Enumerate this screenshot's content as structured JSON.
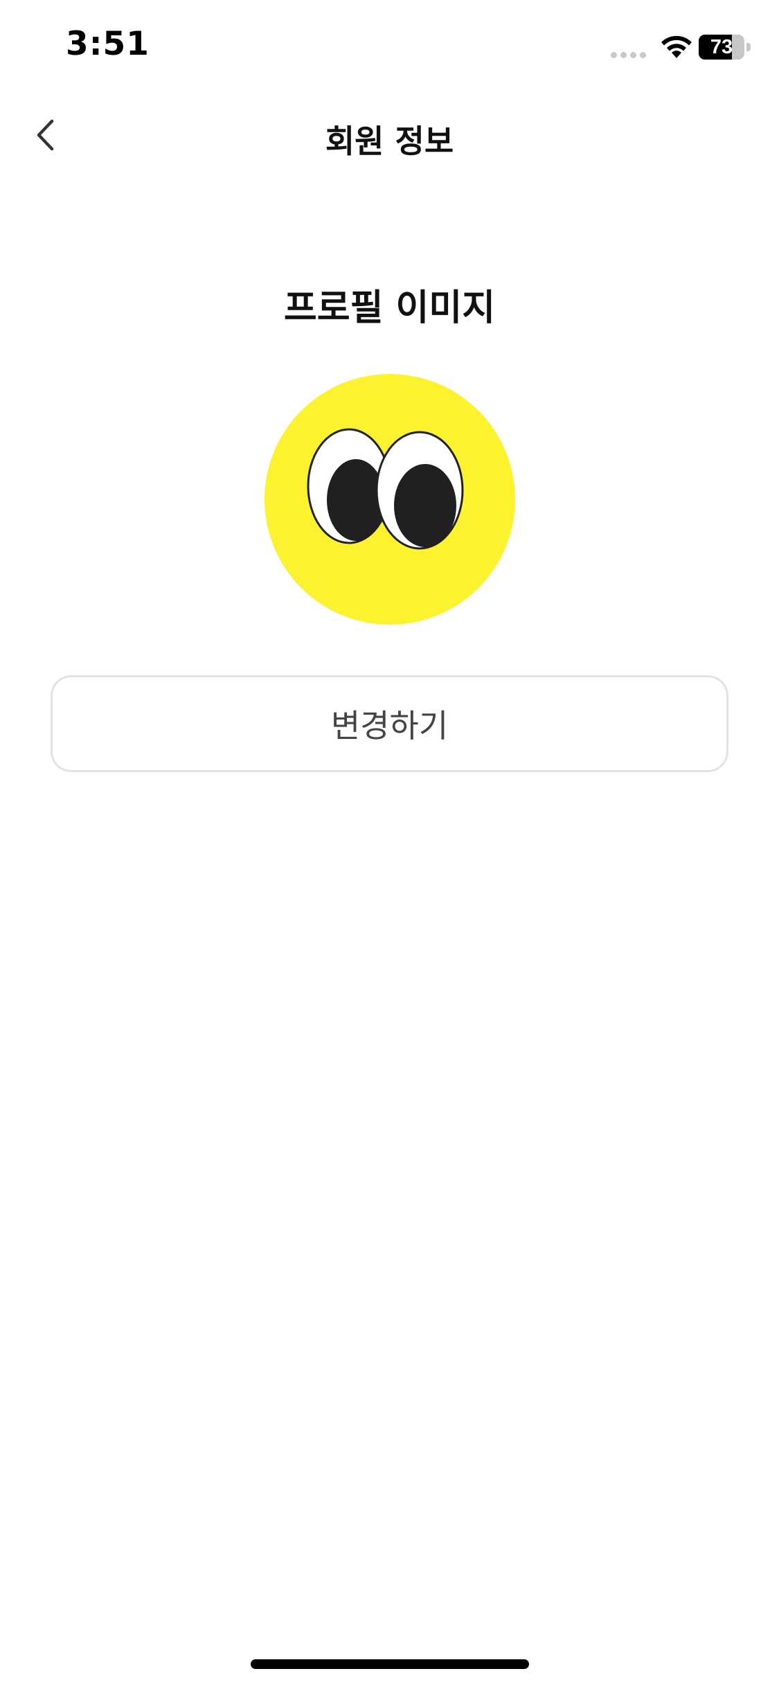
{
  "status_bar": {
    "time": "3:51",
    "battery_level": "73",
    "battery_fraction": 0.73,
    "wifi_icon": "wifi-icon",
    "signal_icon": "cellular-signal-icon"
  },
  "nav": {
    "title": "회원 정보",
    "back_icon": "chevron-left-icon"
  },
  "profile": {
    "section_title": "프로필 이미지",
    "avatar_icon": "googly-eyes-avatar",
    "avatar_color": "#FDF22F",
    "change_button_label": "변경하기"
  },
  "colors": {
    "background": "#FFFFFF",
    "text_primary": "#111111",
    "button_border": "#E3E3E3"
  }
}
